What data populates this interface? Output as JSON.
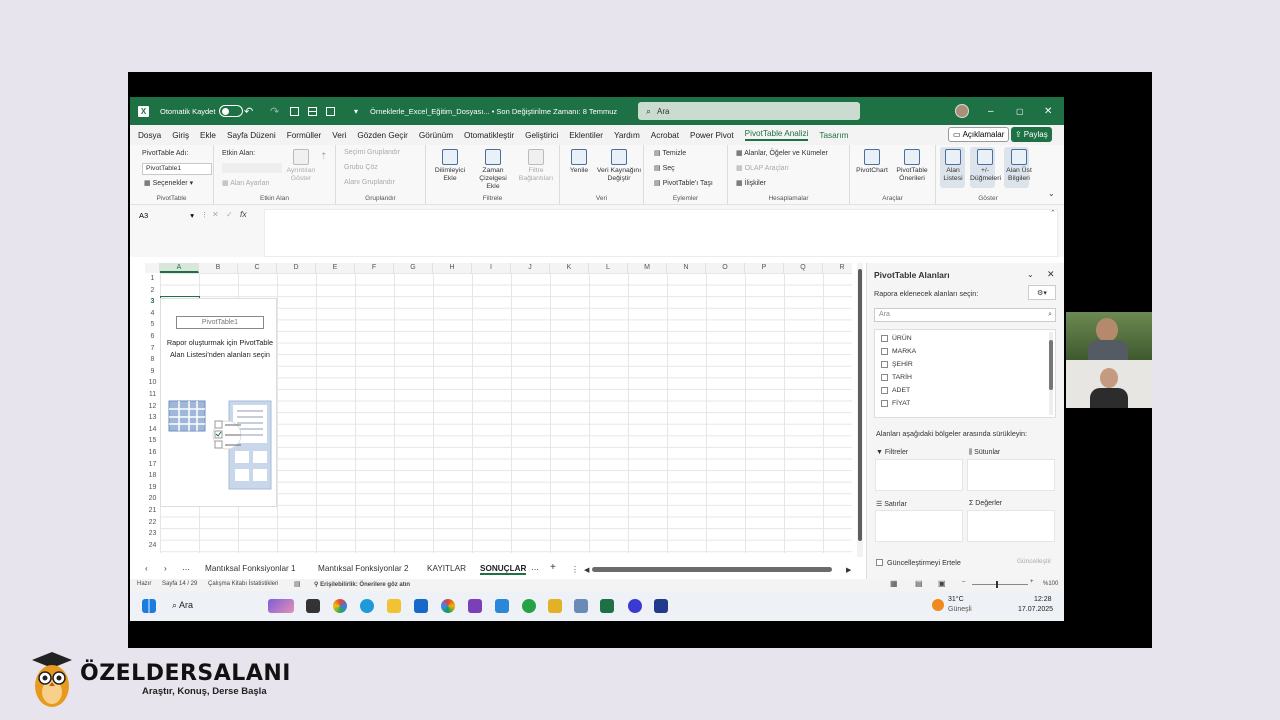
{
  "titlebar": {
    "autosave_label": "Otomatik Kaydet",
    "file_title": "Örneklerle_Excel_Eğitim_Dosyası... • Son Değiştirilme Zamanı: 8 Temmuz",
    "search_placeholder": "Ara"
  },
  "menu": {
    "items": [
      "Dosya",
      "Giriş",
      "Ekle",
      "Sayfa Düzeni",
      "Formüller",
      "Veri",
      "Gözden Geçir",
      "Görünüm",
      "Otomatikleştir",
      "Geliştirici",
      "Eklentiler",
      "Yardım",
      "Acrobat",
      "Power Pivot",
      "PivotTable Analizi",
      "Tasarım"
    ],
    "active": "PivotTable Analizi",
    "comments": "Açıklamalar",
    "share": "Paylaş"
  },
  "ribbon": {
    "pivottable": {
      "name_label": "PivotTable Adı:",
      "name_value": "PivotTable1",
      "options": "Seçenekler",
      "group": "PivotTable"
    },
    "active_field": {
      "label": "Etkin Alan:",
      "field_settings": "Alan Ayarları",
      "drill_down": "Ayrıntıları Göster",
      "drill_up": "Ayrıntıları Gizle",
      "group": "Etkin Alan"
    },
    "grouping": {
      "group_selection": "Seçimi Gruplandır",
      "ungroup": "Grubu Çöz",
      "group_field": "Alanı Gruplandır",
      "group": "Gruplandır"
    },
    "filter": {
      "slicer": "Dilimleyici Ekle",
      "timeline": "Zaman Çizelgesi Ekle",
      "connections": "Filtre Bağlantıları",
      "group": "Filtrele"
    },
    "data": {
      "refresh": "Yenile",
      "change_source": "Veri Kaynağını Değiştir",
      "group": "Veri"
    },
    "actions": {
      "clear": "Temizle",
      "select": "Seç",
      "move": "PivotTable'ı Taşı",
      "group": "Eylemler"
    },
    "calculations": {
      "fields_items": "Alanlar, Öğeler ve Kümeler",
      "olap": "OLAP Araçları",
      "relationships": "İlişkiler",
      "group": "Hesaplamalar"
    },
    "tools": {
      "pivotchart": "PivotChart",
      "recommended": "PivotTable Önerileri",
      "group": "Araçlar"
    },
    "show": {
      "field_list": "Alan Listesi",
      "buttons": "+/- Düğmeleri",
      "headers": "Alan Üst Bilgileri",
      "group": "Göster"
    }
  },
  "formula_bar": {
    "name_box": "A3",
    "fx": "fx"
  },
  "grid": {
    "columns": [
      "A",
      "B",
      "C",
      "D",
      "E",
      "F",
      "G",
      "H",
      "I",
      "J",
      "K",
      "L",
      "M",
      "N",
      "O",
      "P",
      "Q",
      "R"
    ],
    "rows": [
      "1",
      "2",
      "3",
      "4",
      "5",
      "6",
      "7",
      "8",
      "9",
      "10",
      "11",
      "12",
      "13",
      "14",
      "15",
      "16",
      "17",
      "18",
      "19",
      "20",
      "21",
      "22",
      "23",
      "24"
    ],
    "placeholder_name": "PivotTable1",
    "placeholder_msg": "Rapor oluşturmak için PivotTable Alan Listesi'nden alanları seçin"
  },
  "sheets": {
    "tabs": [
      "Mantıksal Fonksiyonlar 1",
      "Mantıksal Fonksiyonlar 2",
      "KAYITLAR",
      "SONUÇLAR"
    ],
    "active": "SONUÇLAR"
  },
  "status": {
    "ready": "Hazır",
    "page": "Sayfa 14 / 29",
    "stats": "Çalışma Kitabı İstatistikleri",
    "accessibility": "Erişilebilirlik: Önerilere göz atın",
    "zoom": "%100"
  },
  "pivot_pane": {
    "title": "PivotTable Alanları",
    "subtitle": "Rapora eklenecek alanları seçin:",
    "search_placeholder": "Ara",
    "fields": [
      "ÜRÜN",
      "MARKA",
      "ŞEHİR",
      "TARİH",
      "ADET",
      "FİYAT"
    ],
    "drag_label": "Alanları aşağıdaki bölgeler arasında sürükleyin:",
    "filters": "Filtreler",
    "columns": "Sütunlar",
    "rows": "Satırlar",
    "values": "Değerler",
    "defer": "Güncelleştirmeyi Ertele",
    "update": "Güncelleştir"
  },
  "taskbar": {
    "search": "Ara",
    "weather_temp": "31°C",
    "weather_desc": "Güneşli",
    "time": "12:28",
    "date": "17.07.2025"
  },
  "brand": {
    "name": "ÖZELDERSALANI",
    "tagline": "Araştır, Konuş, Derse Başla"
  },
  "colors": {
    "excel_green": "#1e7145",
    "background": "#e8e4ee"
  }
}
